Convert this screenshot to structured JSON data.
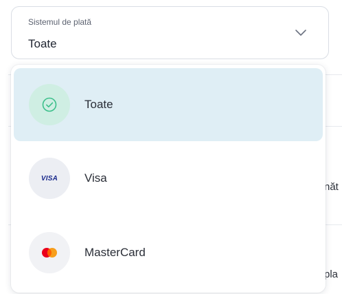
{
  "select": {
    "label": "Sistemul de plată",
    "value": "Toate"
  },
  "menu": {
    "options": [
      {
        "label": "Toate",
        "icon": "check-circle-icon",
        "selected": true
      },
      {
        "label": "Visa",
        "icon": "visa-logo",
        "badge_text": "VISA"
      },
      {
        "label": "MasterCard",
        "icon": "mastercard-logo"
      }
    ]
  },
  "background": {
    "fragment_1": "năt",
    "fragment_2": "pla"
  },
  "colors": {
    "selected_bg": "#dfeef5",
    "check_green": "#3bbf8a",
    "mastercard_red": "#eb001b",
    "mastercard_orange": "#f79e1b"
  }
}
